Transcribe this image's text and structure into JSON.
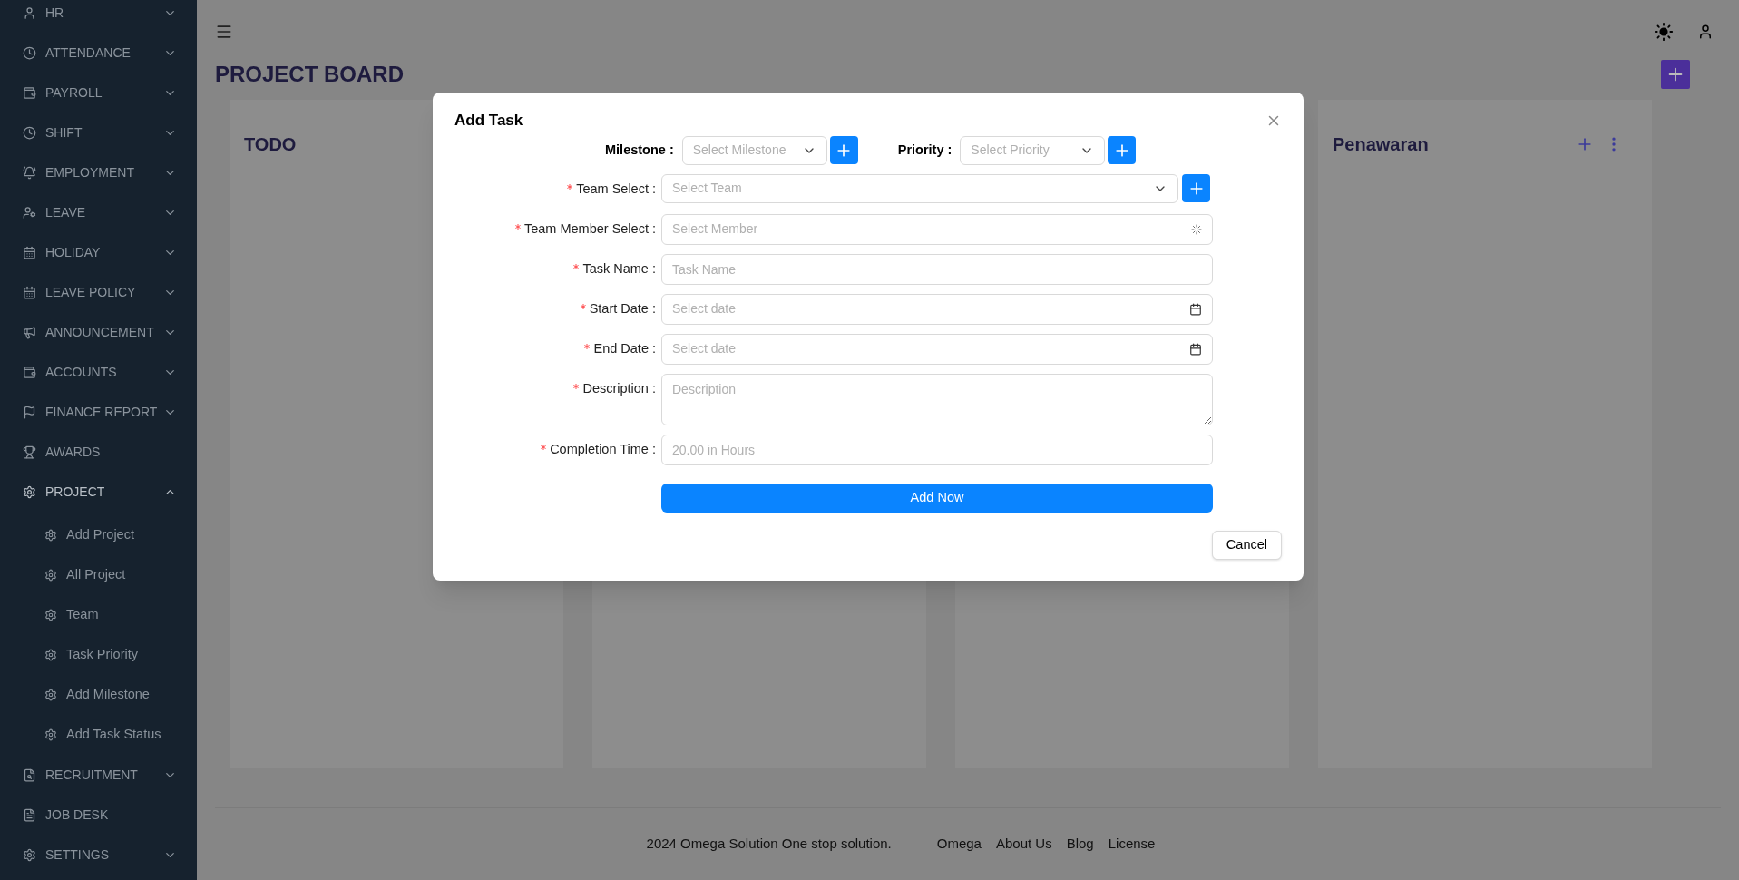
{
  "sidebar": {
    "items": [
      {
        "label": "HR",
        "kind": "group",
        "expanded": false
      },
      {
        "label": "ATTENDANCE",
        "kind": "group",
        "expanded": false
      },
      {
        "label": "PAYROLL",
        "kind": "group",
        "expanded": false
      },
      {
        "label": "SHIFT",
        "kind": "group",
        "expanded": false
      },
      {
        "label": "EMPLOYMENT",
        "kind": "group",
        "expanded": false
      },
      {
        "label": "LEAVE",
        "kind": "group",
        "expanded": false
      },
      {
        "label": "HOLIDAY",
        "kind": "group",
        "expanded": false
      },
      {
        "label": "LEAVE POLICY",
        "kind": "group",
        "expanded": false
      },
      {
        "label": "ANNOUNCEMENT",
        "kind": "group",
        "expanded": false
      },
      {
        "label": "ACCOUNTS",
        "kind": "group",
        "expanded": false
      },
      {
        "label": "FINANCE REPORT",
        "kind": "group",
        "expanded": false
      },
      {
        "label": "AWARDS",
        "kind": "link"
      },
      {
        "label": "PROJECT",
        "kind": "group",
        "expanded": true,
        "children": [
          {
            "label": "Add Project"
          },
          {
            "label": "All Project"
          },
          {
            "label": "Team"
          },
          {
            "label": "Task Priority"
          },
          {
            "label": "Add Milestone"
          },
          {
            "label": "Add Task Status"
          }
        ]
      },
      {
        "label": "RECRUITMENT",
        "kind": "group",
        "expanded": false
      },
      {
        "label": "JOB DESK",
        "kind": "link"
      },
      {
        "label": "SETTINGS",
        "kind": "group",
        "expanded": false
      }
    ]
  },
  "page": {
    "title": "PROJECT BOARD"
  },
  "board": {
    "columns": [
      {
        "title": "TODO"
      },
      {},
      {},
      {
        "title": "Penawaran"
      }
    ]
  },
  "footer": {
    "text": "2024 Omega Solution One stop solution.",
    "links": [
      "Omega",
      "About Us",
      "Blog",
      "License"
    ]
  },
  "modal": {
    "title": "Add Task",
    "top_selects": [
      {
        "label": "Milestone :",
        "placeholder": "Select Milestone"
      },
      {
        "label": "Priority :",
        "placeholder": "Select Priority"
      }
    ],
    "fields": [
      {
        "kind": "select-add",
        "label": "Team Select :",
        "required": true,
        "placeholder": "Select Team"
      },
      {
        "kind": "loading-select",
        "label": "Team Member Select :",
        "required": true,
        "placeholder": "Select Member"
      },
      {
        "kind": "text",
        "label": "Task Name :",
        "required": true,
        "placeholder": "Task Name"
      },
      {
        "kind": "date",
        "label": "Start Date :",
        "required": true,
        "placeholder": "Select date"
      },
      {
        "kind": "date",
        "label": "End Date :",
        "required": true,
        "placeholder": "Select date"
      },
      {
        "kind": "textarea",
        "label": "Description :",
        "required": true,
        "placeholder": "Description"
      },
      {
        "kind": "text",
        "label": "Completion Time :",
        "required": true,
        "placeholder": "20.00 in Hours"
      }
    ],
    "submit": "Add Now",
    "cancel": "Cancel"
  }
}
